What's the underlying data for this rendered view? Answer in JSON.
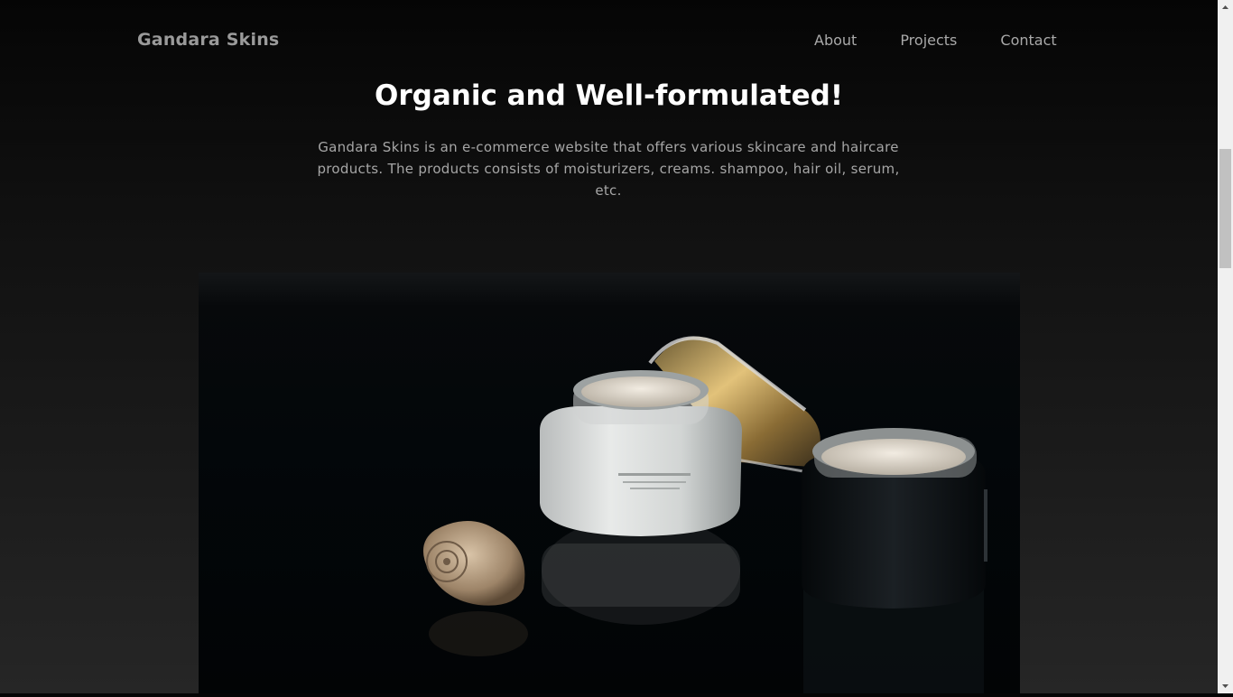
{
  "header": {
    "brand": "Gandara Skins",
    "nav": [
      {
        "label": "About"
      },
      {
        "label": "Projects"
      },
      {
        "label": "Contact"
      }
    ]
  },
  "hero": {
    "title": "Organic and Well-formulated!",
    "description": "Gandara Skins is an e-commerce website that offers various skincare and haircare products. The products consists of moisturizers, creams. shampoo, hair oil, serum, etc."
  },
  "colors": {
    "background_top": "#050505",
    "background_bottom": "#262626",
    "title": "#ffffff",
    "text": "#a6a6a6"
  },
  "scrollbar": {
    "icons": [
      "arrow-up-icon",
      "arrow-down-icon"
    ]
  }
}
